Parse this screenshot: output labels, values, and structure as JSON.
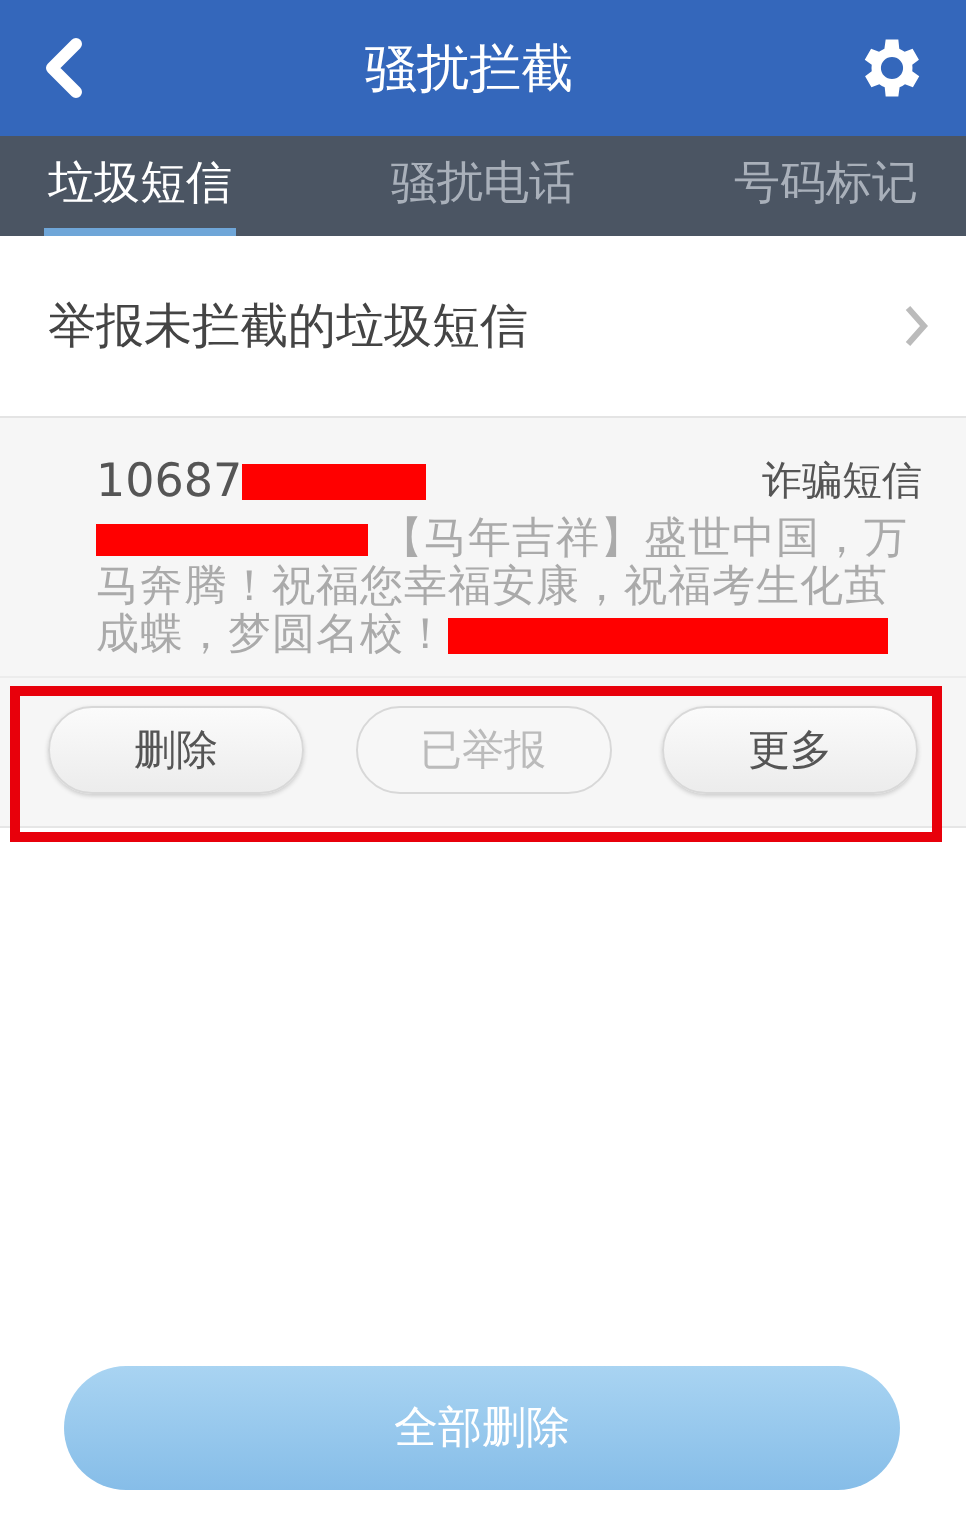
{
  "header": {
    "title": "骚扰拦截"
  },
  "tabs": [
    {
      "label": "垃圾短信",
      "selected": true
    },
    {
      "label": "骚扰电话",
      "selected": false
    },
    {
      "label": "号码标记",
      "selected": false
    }
  ],
  "report_row": {
    "label": "举报未拦截的垃圾短信"
  },
  "message": {
    "sender": "10687",
    "category": "诈骗短信",
    "text_lines": [
      "【马年吉祥】盛世中国，万",
      "马奔腾！祝福您幸福安康，祝福考生化茧",
      "成蝶，梦圆名校！"
    ],
    "redacted": true,
    "actions": [
      {
        "label": "删除",
        "disabled": false
      },
      {
        "label": "已举报",
        "disabled": true
      },
      {
        "label": "更多",
        "disabled": false
      }
    ],
    "highlighted": true
  },
  "bottom_button": {
    "label": "全部删除"
  }
}
